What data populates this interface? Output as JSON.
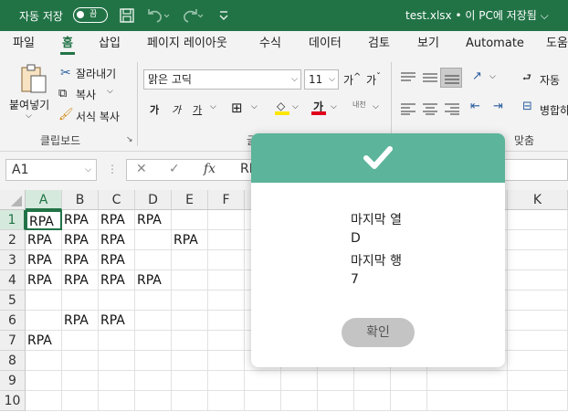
{
  "titlebar": {
    "autosave_label": "자동 저장",
    "autosave_toggle": "끔",
    "doc_title": "test.xlsx • 이 PC에 저장됨 ⌵"
  },
  "tabs": [
    "파일",
    "홈",
    "삽입",
    "페이지 레이아웃",
    "수식",
    "데이터",
    "검토",
    "보기",
    "Automate",
    "도움"
  ],
  "ribbon": {
    "paste": "붙여넣기",
    "cut": "잘라내기",
    "copy": "복사",
    "format_painter": "서식 복사",
    "clipboard_group": "클립보드",
    "font_name": "맑은 고딕",
    "font_size": "11",
    "bold": "가",
    "italic": "가",
    "underline": "가",
    "grow": "가",
    "shrink": "가",
    "font_color_glyph": "가",
    "phonetic": "내천",
    "font_group": "글",
    "wrap": "자동",
    "merge": "병합하",
    "align_group": "맞춤"
  },
  "formula_bar": {
    "name_box": "A1",
    "fx": "fx",
    "formula_value": "RI"
  },
  "grid": {
    "columns": [
      "A",
      "B",
      "C",
      "D",
      "E",
      "F",
      "",
      "",
      "",
      "",
      "",
      "",
      "K"
    ],
    "rows": [
      "1",
      "2",
      "3",
      "4",
      "5",
      "6",
      "7",
      "8",
      "9",
      "10"
    ],
    "cells": [
      [
        "RPA",
        "RPA",
        "RPA",
        "RPA",
        "",
        ""
      ],
      [
        "RPA",
        "RPA",
        "RPA",
        "",
        "RPA",
        ""
      ],
      [
        "RPA",
        "RPA",
        "RPA",
        "",
        "",
        ""
      ],
      [
        "RPA",
        "RPA",
        "RPA",
        "RPA",
        "",
        ""
      ],
      [
        "",
        "",
        "",
        "",
        "",
        ""
      ],
      [
        "",
        "RPA",
        "RPA",
        "",
        "",
        ""
      ],
      [
        "RPA",
        "",
        "",
        "",
        "",
        ""
      ],
      [
        "",
        "",
        "",
        "",
        "",
        ""
      ],
      [
        "",
        "",
        "",
        "",
        "",
        ""
      ],
      [
        "",
        "",
        "",
        "",
        "",
        ""
      ]
    ]
  },
  "dialog": {
    "line1": "마지막 열",
    "line2": "D",
    "line3": "마지막 행",
    "line4": "7",
    "ok_label": "확인"
  },
  "colors": {
    "excel_green": "#217346",
    "dialog_header": "#5cb49a",
    "ok_button": "#c4c4c4"
  }
}
